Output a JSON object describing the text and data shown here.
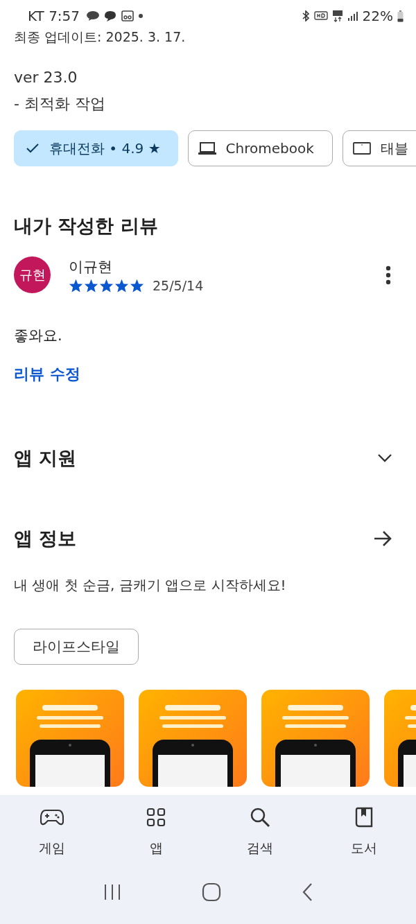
{
  "status_bar": {
    "carrier_time": "KT 7:57",
    "battery": "22%"
  },
  "updated": "최종 업데이트: 2025. 3. 17.",
  "version": "ver 23.0",
  "changes": "- 최적화 작업",
  "device_chips": [
    {
      "label": "휴대전화 • 4.9 ★",
      "selected": true
    },
    {
      "label": "Chromebook",
      "kind": "laptop",
      "selected": false
    },
    {
      "label": "태블",
      "kind": "tablet",
      "selected": false
    }
  ],
  "my_review": {
    "title": "내가 작성한 리뷰",
    "avatar": "규현",
    "name": "이규현",
    "stars": 5,
    "date": "25/5/14",
    "text": "좋와요.",
    "edit_link": "리뷰 수정"
  },
  "app_support": {
    "title": "앱 지원",
    "expanded": false
  },
  "app_info": {
    "title": "앱 정보",
    "description": "내 생애 첫 순금, 금캐기 앱으로 시작하세요!",
    "category": "라이프스타일"
  },
  "bottom_nav": [
    {
      "label": "게임",
      "kind": "gamepad",
      "selected": false
    },
    {
      "label": "앱",
      "kind": "apps",
      "selected": false
    },
    {
      "label": "검색",
      "kind": "search",
      "selected": false
    },
    {
      "label": "도서",
      "kind": "book",
      "selected": false
    }
  ]
}
